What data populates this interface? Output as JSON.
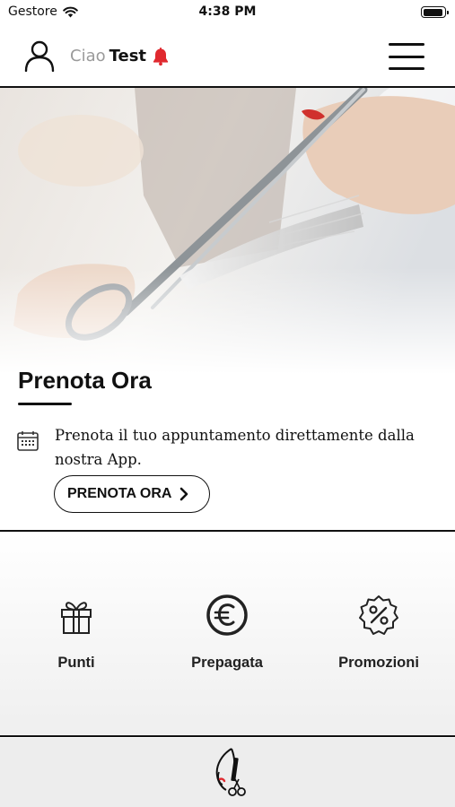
{
  "status_bar": {
    "carrier": "Gestore",
    "time": "4:38 PM",
    "battery_level": 0.95
  },
  "header": {
    "greeting": "Ciao",
    "user_name": "Test",
    "bell_color": "#e0292f"
  },
  "hero": {
    "title": "Prenota Ora",
    "description": "Prenota il tuo appuntamento direttamente dalla nostra App.",
    "button_label": "PRENOTA ORA"
  },
  "services": [
    {
      "label": "Punti",
      "icon": "gift-icon"
    },
    {
      "label": "Prepagata",
      "icon": "euro-coin-icon"
    },
    {
      "label": "Promozioni",
      "icon": "percent-badge-icon"
    }
  ],
  "colors": {
    "accent": "#e0292f",
    "text": "#111111",
    "muted": "#9a9a9a"
  }
}
